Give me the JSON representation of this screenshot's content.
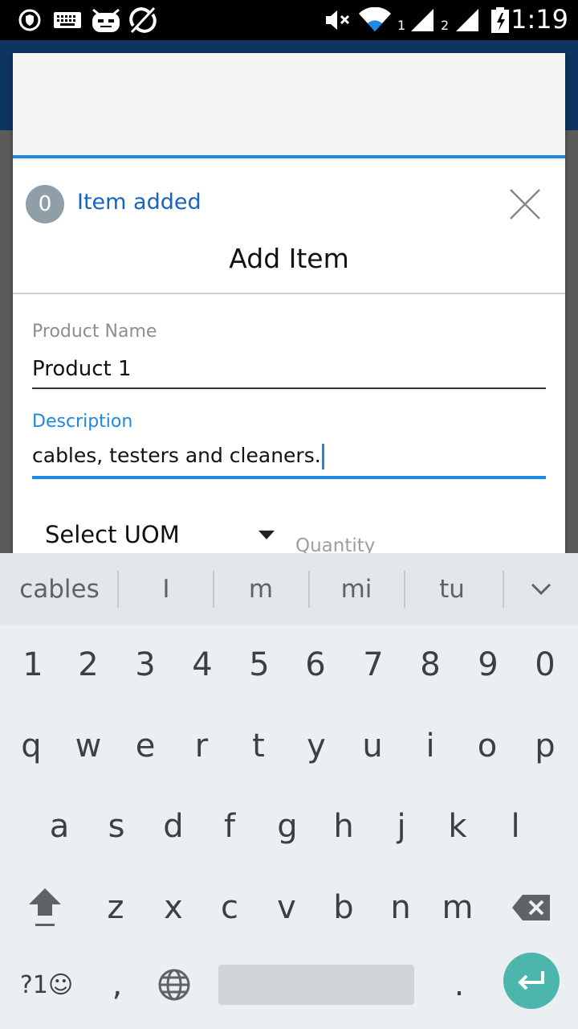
{
  "status_bar": {
    "time": "1:19",
    "sim1": "1",
    "sim2": "2",
    "icons": [
      "location-shield-icon",
      "keyboard-icon",
      "android-icon",
      "sync-disabled-icon",
      "mute-icon",
      "wifi-icon",
      "signal-icon",
      "signal-icon",
      "battery-icon"
    ]
  },
  "dialog": {
    "badge_count": "0",
    "status_text": "Item added",
    "title": "Add Item",
    "close_icon": "close-icon"
  },
  "form": {
    "product_name_label": "Product Name",
    "product_name_value": "Product 1",
    "description_label": "Description",
    "description_value": "cables, testers and cleaners.",
    "uom_select": "Select UOM",
    "quantity_label": "Quantity"
  },
  "keyboard": {
    "suggestions": [
      "cables",
      "I",
      "m",
      "mi",
      "tu"
    ],
    "number_row": [
      "1",
      "2",
      "3",
      "4",
      "5",
      "6",
      "7",
      "8",
      "9",
      "0"
    ],
    "row1": [
      "q",
      "w",
      "e",
      "r",
      "t",
      "y",
      "u",
      "i",
      "o",
      "p"
    ],
    "row2": [
      "a",
      "s",
      "d",
      "f",
      "g",
      "h",
      "j",
      "k",
      "l"
    ],
    "row3": [
      "z",
      "x",
      "c",
      "v",
      "b",
      "n",
      "m"
    ],
    "symbols_key": "?1☺",
    "comma_key": ",",
    "period_key": ".",
    "colors": {
      "enter": "#4db6ac",
      "accent": "#1e88e5",
      "link": "#1565c0"
    }
  }
}
